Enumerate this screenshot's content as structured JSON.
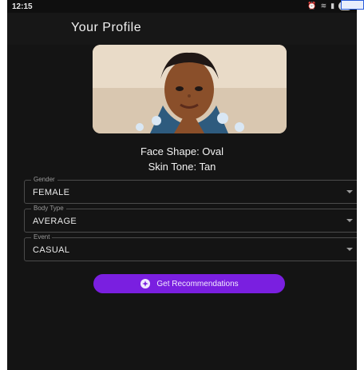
{
  "status_bar": {
    "time": "12:15",
    "battery": "75",
    "icons": [
      "alarm-icon",
      "wifi-icon",
      "signal-icon",
      "battery-icon"
    ]
  },
  "header": {
    "title": "Your Profile"
  },
  "analysis": {
    "face_shape": "Face Shape: Oval",
    "skin_tone": "Skin Tone: Tan"
  },
  "form": {
    "gender": {
      "label": "Gender",
      "value": "FEMALE"
    },
    "body_type": {
      "label": "Body Type",
      "value": "AVERAGE"
    },
    "event": {
      "label": "Event",
      "value": "CASUAL"
    }
  },
  "action": {
    "label": "Get Recommendations",
    "icon": "sparkle-icon"
  },
  "colors": {
    "background": "#141414",
    "button": "#7a1fe0",
    "text": "#f1f1f1"
  }
}
